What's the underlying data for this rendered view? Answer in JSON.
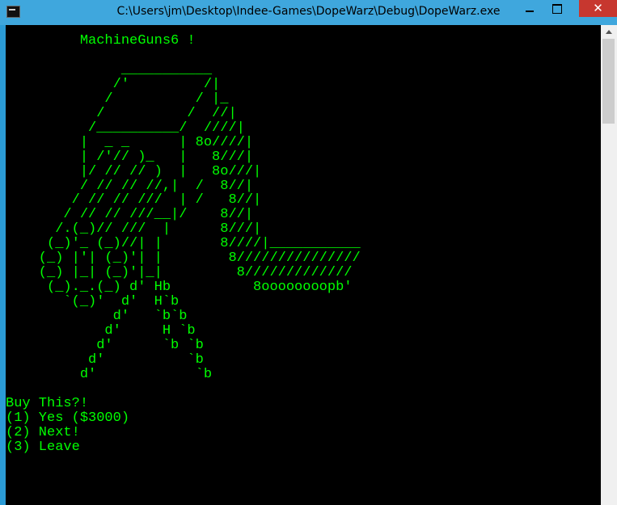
{
  "window": {
    "title": "C:\\Users\\jm\\Desktop\\Indee-Games\\DopeWarz\\Debug\\DopeWarz.exe",
    "close_glyph": "✕"
  },
  "console": {
    "lines": [
      "         MachineGuns6 !",
      "",
      "              ___________",
      "             /'         /|",
      "            /          / |_",
      "           /          /  //|",
      "          /__________/  ////|",
      "         |  _ _      | 8o////|",
      "         | /'// )_   |   8///|",
      "         |/ // // )  |   8o///|",
      "         / // // //,|  /  8//|",
      "        / // // ///  | /   8//|",
      "       / // // ///__|/    8//|",
      "      /.(_)// ///  |      8///|",
      "     (_)'_ (_)//| |       8////|___________",
      "    (_) |'| (_)'| |        8///////////////",
      "    (_) |_| (_)'|_|         8/////////////",
      "     (_)._.(_) d' Hb          8oooooooopb'",
      "       `(_)'  d'  H`b",
      "             d'   `b`b",
      "            d'     H `b",
      "           d'      `b `b",
      "          d'          `b",
      "         d'            `b",
      "",
      "Buy This?!",
      "(1) Yes ($3000)",
      "(2) Next!",
      "(3) Leave"
    ]
  },
  "colors": {
    "console_bg": "#000000",
    "console_fg": "#00ff00",
    "titlebar": "#3fa7dd",
    "close_button": "#c7372f"
  }
}
